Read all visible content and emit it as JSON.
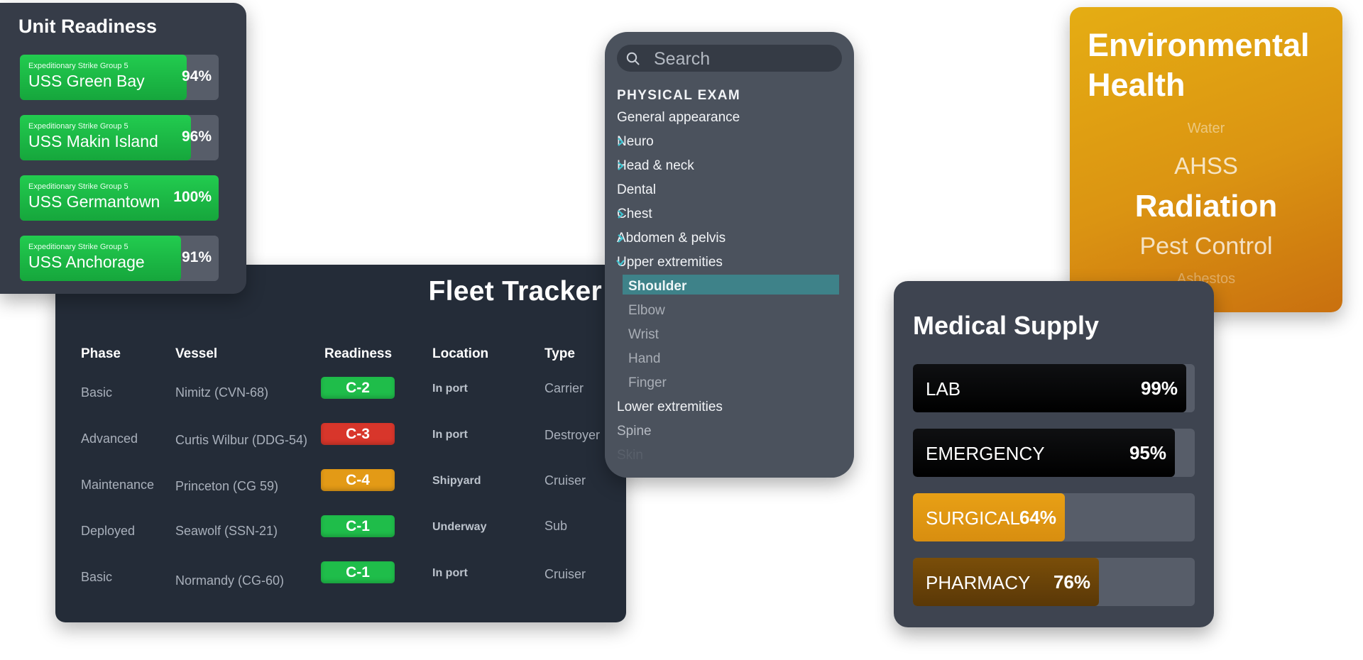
{
  "fleet": {
    "title": "Fleet Tracker",
    "headers": [
      "Phase",
      "Vessel",
      "Readiness",
      "Location",
      "Type"
    ],
    "rows": [
      {
        "phase": "Basic",
        "vessel": "Nimitz (CVN-68)",
        "readiness": "C-2",
        "readiness_color": "#1fbd4a",
        "location": "In port",
        "type": "Carrier"
      },
      {
        "phase": "Advanced",
        "vessel": "Curtis Wilbur (DDG-54)",
        "readiness": "C-3",
        "readiness_color": "#d8362b",
        "location": "In port",
        "type": "Destroyer"
      },
      {
        "phase": "Maintenance",
        "vessel": "Princeton (CG 59)",
        "readiness": "C-4",
        "readiness_color": "#e39a16",
        "location": "Shipyard",
        "type": "Cruiser"
      },
      {
        "phase": "Deployed",
        "vessel": "Seawolf (SSN-21)",
        "readiness": "C-1",
        "readiness_color": "#1fbd4a",
        "location": "Underway",
        "type": "Sub"
      },
      {
        "phase": "Basic",
        "vessel": "Normandy (CG-60)",
        "readiness": "C-1",
        "readiness_color": "#1fbd4a",
        "location": "In port",
        "type": "Cruiser"
      }
    ]
  },
  "unit": {
    "title": "Unit Readiness",
    "units": [
      {
        "group": "Expeditionary Strike Group 5",
        "name": "USS Green Bay",
        "percent_label": "94%",
        "level": 0.94
      },
      {
        "group": "Expeditionary Strike Group 5",
        "name": "USS Makin Island",
        "percent_label": "96%",
        "level": 0.96
      },
      {
        "group": "Expeditionary Strike Group 5",
        "name": "USS Germantown",
        "percent_label": "100%",
        "level": 1.0
      },
      {
        "group": "Expeditionary Strike Group 5",
        "name": "USS Anchorage",
        "percent_label": "91%",
        "level": 0.91
      }
    ]
  },
  "exam": {
    "search_placeholder": "Search",
    "section": "PHYSICAL EXAM",
    "items": [
      {
        "label": "General appearance",
        "chevron": "none",
        "indent": 0,
        "style": "normal"
      },
      {
        "label": "Neuro",
        "chevron": "right",
        "indent": 0,
        "style": "normal"
      },
      {
        "label": "Head & neck",
        "chevron": "right",
        "indent": 0,
        "style": "normal"
      },
      {
        "label": "Dental",
        "chevron": "none",
        "indent": 0,
        "style": "normal"
      },
      {
        "label": "Chest",
        "chevron": "right",
        "indent": 0,
        "style": "normal"
      },
      {
        "label": "Abdomen & pelvis",
        "chevron": "right",
        "indent": 0,
        "style": "normal"
      },
      {
        "label": "Upper extremities",
        "chevron": "down",
        "indent": 0,
        "style": "normal"
      },
      {
        "label": "Shoulder",
        "chevron": "none",
        "indent": 1,
        "style": "selected"
      },
      {
        "label": "Elbow",
        "chevron": "none",
        "indent": 1,
        "style": "muted"
      },
      {
        "label": "Wrist",
        "chevron": "none",
        "indent": 1,
        "style": "muted"
      },
      {
        "label": "Hand",
        "chevron": "none",
        "indent": 1,
        "style": "muted"
      },
      {
        "label": "Finger",
        "chevron": "none",
        "indent": 1,
        "style": "muted"
      },
      {
        "label": "Lower extremities",
        "chevron": "none",
        "indent": 0,
        "style": "normal"
      },
      {
        "label": "Spine",
        "chevron": "none",
        "indent": 0,
        "style": "dim"
      },
      {
        "label": "Skin",
        "chevron": "none",
        "indent": 0,
        "style": "faint"
      }
    ],
    "accent_color": "#3fc3d0"
  },
  "env": {
    "title": "Environmental Health",
    "options": [
      "Water",
      "AHSS",
      "Radiation",
      "Pest Control",
      "Asbestos"
    ],
    "selected": "Radiation"
  },
  "med": {
    "title": "Medical Supply",
    "bars": [
      {
        "label": "LAB",
        "percent_label": "99%",
        "level": 0.99,
        "color": "black"
      },
      {
        "label": "EMERGENCY",
        "percent_label": "95%",
        "level": 0.95,
        "color": "black"
      },
      {
        "label": "SURGICAL",
        "percent_label": "64%",
        "level": 0.64,
        "color": "amber"
      },
      {
        "label": "PHARMACY",
        "percent_label": "76%",
        "level": 0.76,
        "color": "brown"
      }
    ]
  }
}
